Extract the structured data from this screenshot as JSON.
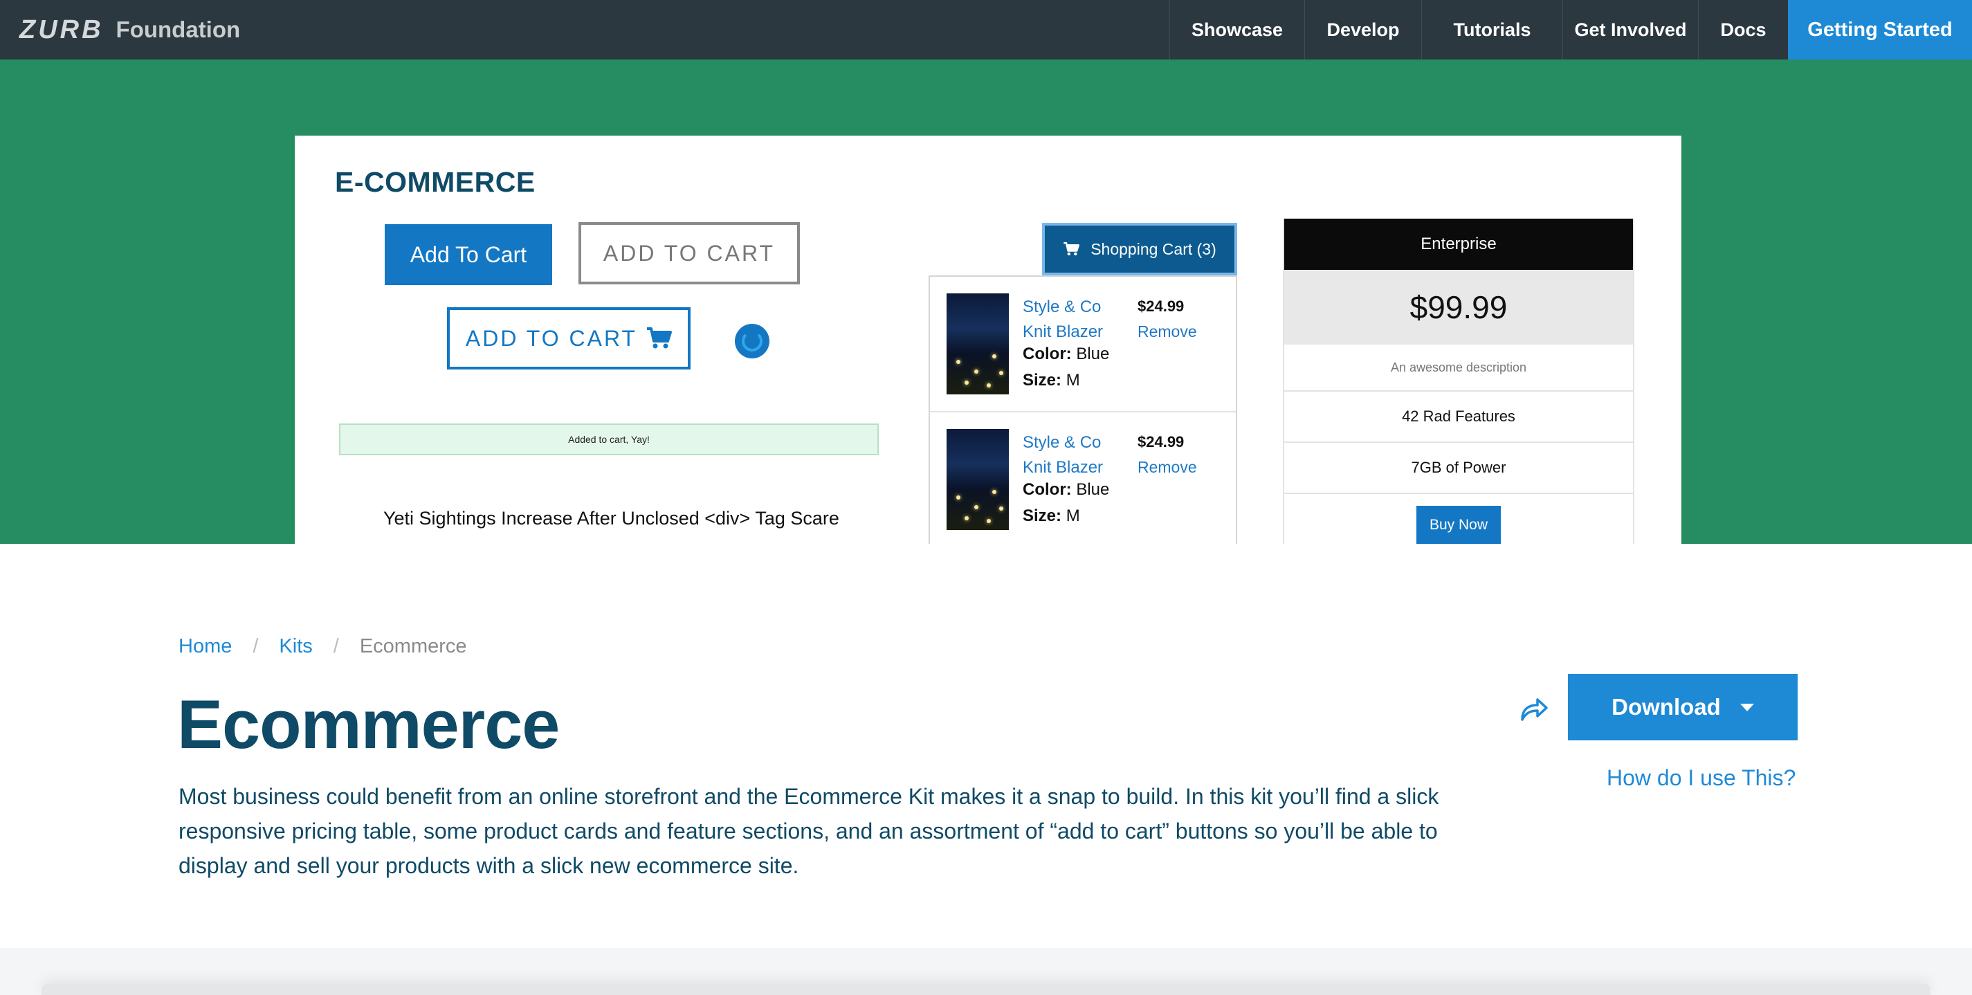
{
  "brand": {
    "logo_text": "ZURB",
    "name": "Foundation"
  },
  "nav": {
    "items": [
      {
        "label": "Showcase"
      },
      {
        "label": "Develop"
      },
      {
        "label": "Tutorials"
      },
      {
        "label": "Get Involved"
      },
      {
        "label": "Docs"
      }
    ],
    "cta_label": "Getting Started"
  },
  "hero": {
    "background": "#268c62",
    "preview": {
      "title": "E-COMMERCE",
      "button_solid": "Add To Cart",
      "button_outline_gray": "ADD TO CART",
      "button_outline_blue": "ADD TO CART",
      "alert": "Added to cart, Yay!",
      "headline": "Yeti Sightings Increase After Unclosed <div> Tag Scare",
      "cart": {
        "button_label": "Shopping Cart (3)",
        "items": [
          {
            "name": "Style & Co Knit Blazer",
            "color_label": "Color:",
            "color": "Blue",
            "size_label": "Size:",
            "size": "M",
            "price": "$24.99",
            "remove": "Remove"
          },
          {
            "name": "Style & Co Knit Blazer",
            "color_label": "Color:",
            "color": "Blue",
            "size_label": "Size:",
            "size": "M",
            "price": "$24.99",
            "remove": "Remove"
          }
        ]
      },
      "pricing": {
        "plan": "Enterprise",
        "price": "$99.99",
        "description": "An awesome description",
        "features": [
          "42 Rad Features",
          "7GB of Power"
        ],
        "buy_label": "Buy Now"
      }
    }
  },
  "breadcrumb": {
    "items": [
      "Home",
      "Kits"
    ],
    "current": "Ecommerce",
    "separator": "/"
  },
  "page": {
    "title": "Ecommerce",
    "description": "Most business could benefit from an online storefront and the Ecommerce Kit makes it a snap to build. In this kit you’ll find a slick responsive pricing table, some product cards and feature sections, and an assortment of “add to cart” buttons so you’ll be able to display and sell your products with a slick new ecommerce site."
  },
  "actions": {
    "download_label": "Download",
    "howto_label": "How do I use This?"
  },
  "icons": {
    "cart": "cart-icon",
    "share": "share-icon",
    "spinner": "spinner-icon",
    "caret": "caret-down-icon"
  },
  "colors": {
    "nav_bg": "#2c3840",
    "accent": "#1e8ad6",
    "title": "#0f4a66"
  }
}
